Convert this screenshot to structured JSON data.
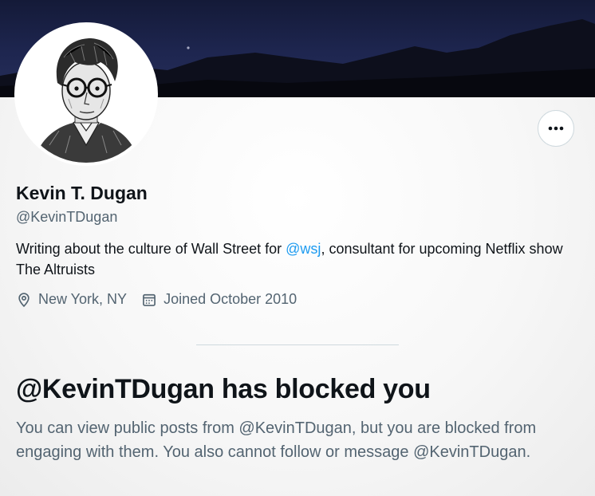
{
  "profile": {
    "name": "Kevin T. Dugan",
    "handle": "@KevinTDugan",
    "bio_before": "Writing about the culture of Wall Street for ",
    "bio_mention": "@wsj",
    "bio_after": ", consultant for upcoming Netflix show The Altruists",
    "location": "New York, NY",
    "joined": "Joined October 2010"
  },
  "actions": {
    "more_icon": "ellipsis-icon"
  },
  "blocked": {
    "title": "@KevinTDugan has blocked you",
    "description": "You can view public posts from @KevinTDugan, but you are blocked from engaging with them. You also cannot follow or message @KevinTDugan."
  },
  "colors": {
    "link": "#1d9bf0",
    "secondary_text": "#536471",
    "primary_text": "#0f1419",
    "banner": "#1e2650"
  }
}
